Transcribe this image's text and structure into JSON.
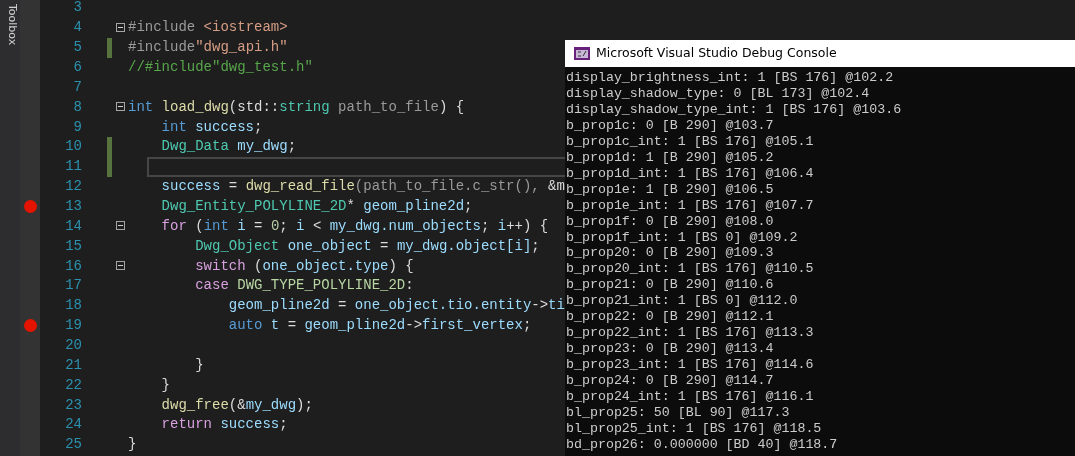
{
  "toolbox": {
    "label": "Toolbox"
  },
  "editor": {
    "lines": [
      {
        "number": "3",
        "breakpoint": false,
        "changed": false,
        "foldable": false,
        "current": false
      },
      {
        "number": "4",
        "breakpoint": false,
        "changed": false,
        "foldable": true,
        "current": false,
        "tokens": [
          {
            "kind": "directive",
            "text": "#include"
          },
          {
            "kind": "string",
            "text": " <iostream>"
          }
        ]
      },
      {
        "number": "5",
        "breakpoint": false,
        "changed": true,
        "foldable": false,
        "current": false,
        "tokens": [
          {
            "kind": "directive",
            "text": "#include"
          },
          {
            "kind": "string",
            "text": "\"dwg_api.h\""
          }
        ]
      },
      {
        "number": "6",
        "breakpoint": false,
        "changed": false,
        "foldable": false,
        "current": false,
        "tokens": [
          {
            "kind": "comment",
            "text": "//#include\"dwg_test.h\""
          }
        ]
      },
      {
        "number": "7",
        "breakpoint": false,
        "changed": false,
        "foldable": false,
        "current": false
      },
      {
        "number": "8",
        "breakpoint": false,
        "changed": false,
        "foldable": true,
        "current": false,
        "tokens": [
          {
            "kind": "keyword",
            "text": "int"
          },
          {
            "kind": "function",
            "text": " load_dwg"
          },
          {
            "kind": "plain",
            "text": "(std::"
          },
          {
            "kind": "type",
            "text": "string"
          },
          {
            "kind": "param",
            "text": " path_to_file"
          },
          {
            "kind": "plain",
            "text": ") {"
          }
        ]
      },
      {
        "number": "9",
        "breakpoint": false,
        "changed": false,
        "foldable": false,
        "current": false,
        "tokens": [
          {
            "kind": "keyword",
            "text": "    int"
          },
          {
            "kind": "variable",
            "text": " success"
          },
          {
            "kind": "plain",
            "text": ";"
          }
        ]
      },
      {
        "number": "10",
        "breakpoint": false,
        "changed": true,
        "foldable": false,
        "current": false,
        "tokens": [
          {
            "kind": "type",
            "text": "    Dwg_Data"
          },
          {
            "kind": "variable",
            "text": " my_dwg"
          },
          {
            "kind": "plain",
            "text": ";"
          }
        ]
      },
      {
        "number": "11",
        "breakpoint": false,
        "changed": true,
        "foldable": false,
        "current": true
      },
      {
        "number": "12",
        "breakpoint": false,
        "changed": false,
        "foldable": false,
        "current": false,
        "tokens": [
          {
            "kind": "variable",
            "text": "    success"
          },
          {
            "kind": "plain",
            "text": " = "
          },
          {
            "kind": "function",
            "text": "dwg_read_file"
          },
          {
            "kind": "param",
            "text": "(path_to_file.c_str(),"
          },
          {
            "kind": "plain",
            "text": " &m"
          }
        ]
      },
      {
        "number": "13",
        "breakpoint": true,
        "changed": false,
        "foldable": false,
        "current": false,
        "tokens": [
          {
            "kind": "type",
            "text": "    Dwg_Entity_POLYLINE_2D"
          },
          {
            "kind": "plain",
            "text": "*"
          },
          {
            "kind": "variable",
            "text": " geom_pline2d"
          },
          {
            "kind": "plain",
            "text": ";"
          }
        ]
      },
      {
        "number": "14",
        "breakpoint": false,
        "changed": false,
        "foldable": true,
        "current": false,
        "tokens": [
          {
            "kind": "control",
            "text": "    for"
          },
          {
            "kind": "plain",
            "text": " ("
          },
          {
            "kind": "keyword",
            "text": "int"
          },
          {
            "kind": "variable",
            "text": " i"
          },
          {
            "kind": "plain",
            "text": " = "
          },
          {
            "kind": "number",
            "text": "0"
          },
          {
            "kind": "plain",
            "text": "; "
          },
          {
            "kind": "variable",
            "text": "i"
          },
          {
            "kind": "plain",
            "text": " < "
          },
          {
            "kind": "variable",
            "text": "my_dwg.num_objects"
          },
          {
            "kind": "plain",
            "text": "; "
          },
          {
            "kind": "variable",
            "text": "i"
          },
          {
            "kind": "plain",
            "text": "++) {"
          }
        ]
      },
      {
        "number": "15",
        "breakpoint": false,
        "changed": false,
        "foldable": false,
        "current": false,
        "tokens": [
          {
            "kind": "type",
            "text": "        Dwg_Object"
          },
          {
            "kind": "variable",
            "text": " one_object"
          },
          {
            "kind": "plain",
            "text": " = "
          },
          {
            "kind": "variable",
            "text": "my_dwg.object[i]"
          },
          {
            "kind": "plain",
            "text": ";"
          }
        ]
      },
      {
        "number": "16",
        "breakpoint": false,
        "changed": false,
        "foldable": true,
        "current": false,
        "tokens": [
          {
            "kind": "control",
            "text": "        switch"
          },
          {
            "kind": "plain",
            "text": " ("
          },
          {
            "kind": "variable",
            "text": "one_object.type"
          },
          {
            "kind": "plain",
            "text": ") {"
          }
        ]
      },
      {
        "number": "17",
        "breakpoint": false,
        "changed": false,
        "foldable": false,
        "current": false,
        "tokens": [
          {
            "kind": "control",
            "text": "        case"
          },
          {
            "kind": "enum",
            "text": " DWG_TYPE_POLYLINE_2D"
          },
          {
            "kind": "plain",
            "text": ":"
          }
        ]
      },
      {
        "number": "18",
        "breakpoint": false,
        "changed": false,
        "foldable": false,
        "current": false,
        "tokens": [
          {
            "kind": "variable",
            "text": "            geom_pline2d"
          },
          {
            "kind": "plain",
            "text": " = "
          },
          {
            "kind": "variable",
            "text": "one_object.tio.entity"
          },
          {
            "kind": "plain",
            "text": "->"
          },
          {
            "kind": "variable",
            "text": "ti"
          }
        ]
      },
      {
        "number": "19",
        "breakpoint": true,
        "changed": false,
        "foldable": false,
        "current": false,
        "tokens": [
          {
            "kind": "keyword",
            "text": "            auto"
          },
          {
            "kind": "variable",
            "text": " t"
          },
          {
            "kind": "plain",
            "text": " = "
          },
          {
            "kind": "variable",
            "text": "geom_pline2d"
          },
          {
            "kind": "plain",
            "text": "->"
          },
          {
            "kind": "variable",
            "text": "first_vertex"
          },
          {
            "kind": "plain",
            "text": ";"
          }
        ]
      },
      {
        "number": "20",
        "breakpoint": false,
        "changed": false,
        "foldable": false,
        "current": false
      },
      {
        "number": "21",
        "breakpoint": false,
        "changed": false,
        "foldable": false,
        "current": false,
        "tokens": [
          {
            "kind": "plain",
            "text": "        }"
          }
        ]
      },
      {
        "number": "22",
        "breakpoint": false,
        "changed": false,
        "foldable": false,
        "current": false,
        "tokens": [
          {
            "kind": "plain",
            "text": "    }"
          }
        ]
      },
      {
        "number": "23",
        "breakpoint": false,
        "changed": false,
        "foldable": false,
        "current": false,
        "tokens": [
          {
            "kind": "function",
            "text": "    dwg_free"
          },
          {
            "kind": "plain",
            "text": "(&"
          },
          {
            "kind": "variable",
            "text": "my_dwg"
          },
          {
            "kind": "plain",
            "text": ");"
          }
        ]
      },
      {
        "number": "24",
        "breakpoint": false,
        "changed": false,
        "foldable": false,
        "current": false,
        "tokens": [
          {
            "kind": "control",
            "text": "    return"
          },
          {
            "kind": "variable",
            "text": " success"
          },
          {
            "kind": "plain",
            "text": ";"
          }
        ]
      },
      {
        "number": "25",
        "breakpoint": false,
        "changed": false,
        "foldable": false,
        "current": false,
        "tokens": [
          {
            "kind": "plain",
            "text": "}"
          }
        ]
      }
    ]
  },
  "console": {
    "title": "Microsoft Visual Studio Debug Console",
    "lines": [
      "display_brightness_int: 1 [BS 176] @102.2",
      "display_shadow_type: 0 [BL 173] @102.4",
      "display_shadow_type_int: 1 [BS 176] @103.6",
      "b_prop1c: 0 [B 290] @103.7",
      "b_prop1c_int: 1 [BS 176] @105.1",
      "b_prop1d: 1 [B 290] @105.2",
      "b_prop1d_int: 1 [BS 176] @106.4",
      "b_prop1e: 1 [B 290] @106.5",
      "b_prop1e_int: 1 [BS 176] @107.7",
      "b_prop1f: 0 [B 290] @108.0",
      "b_prop1f_int: 1 [BS 0] @109.2",
      "b_prop20: 0 [B 290] @109.3",
      "b_prop20_int: 1 [BS 176] @110.5",
      "b_prop21: 0 [B 290] @110.6",
      "b_prop21_int: 1 [BS 0] @112.0",
      "b_prop22: 0 [B 290] @112.1",
      "b_prop22_int: 1 [BS 176] @113.3",
      "b_prop23: 0 [B 290] @113.4",
      "b_prop23_int: 1 [BS 176] @114.6",
      "b_prop24: 0 [B 290] @114.7",
      "b_prop24_int: 1 [BS 176] @116.1",
      "bl_prop25: 50 [BL 90] @117.3",
      "bl_prop25_int: 1 [BS 176] @118.5",
      "bd_prop26: 0.000000 [BD 40] @118.7"
    ]
  }
}
